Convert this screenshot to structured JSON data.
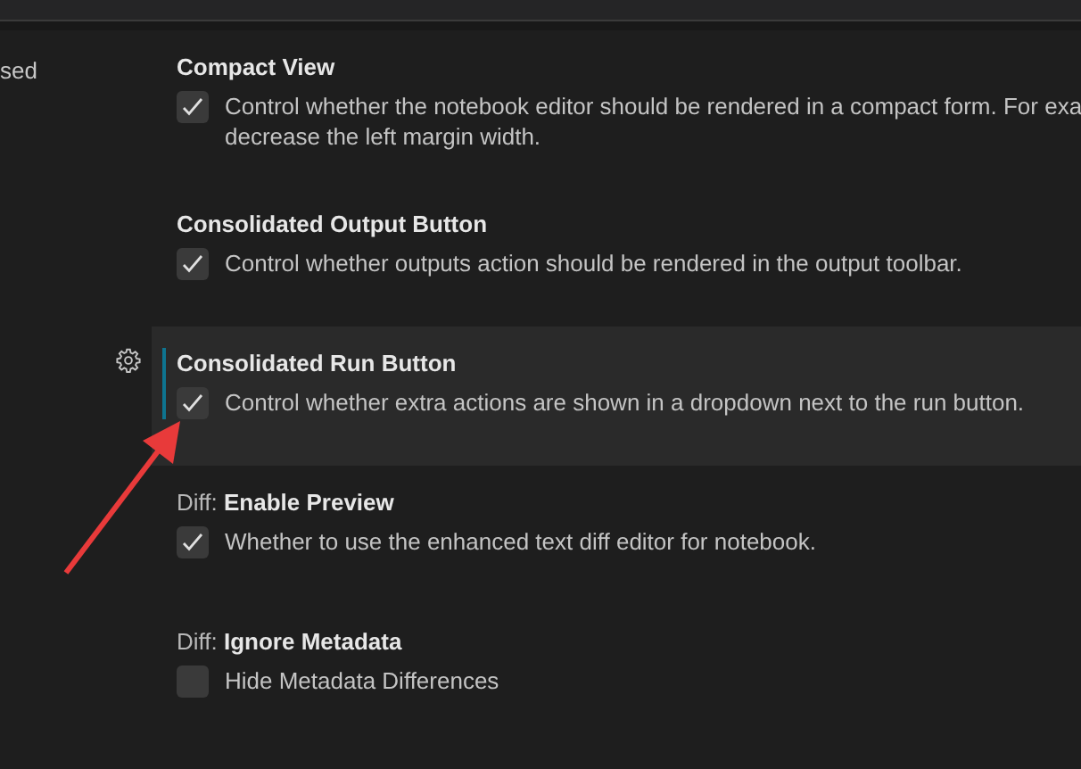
{
  "sidebar": {
    "text": "sed"
  },
  "settings": [
    {
      "title": "Compact View",
      "checked": true,
      "focused": false,
      "description_lines": [
        "Control whether the notebook editor should be rendered in a compact form. For exa",
        "decrease the left margin width."
      ]
    },
    {
      "title": "Consolidated Output Button",
      "checked": true,
      "focused": false,
      "description_lines": [
        "Control whether outputs action should be rendered in the output toolbar."
      ]
    },
    {
      "title": "Consolidated Run Button",
      "checked": true,
      "focused": true,
      "description_lines": [
        "Control whether extra actions are shown in a dropdown next to the run button."
      ]
    },
    {
      "category": "Diff: ",
      "title": "Enable Preview",
      "checked": true,
      "focused": false,
      "description_lines": [
        "Whether to use the enhanced text diff editor for notebook."
      ]
    },
    {
      "category": "Diff: ",
      "title": "Ignore Metadata",
      "checked": false,
      "focused": false,
      "description_lines": [
        "Hide Metadata Differences"
      ]
    }
  ],
  "annotation_arrow": true
}
